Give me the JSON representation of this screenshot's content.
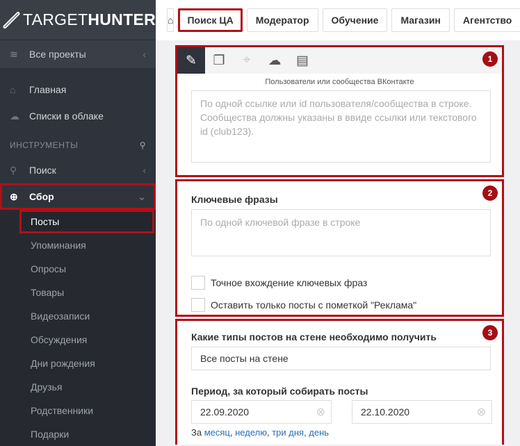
{
  "logo": {
    "light": "TARGET",
    "bold": "HUNTER"
  },
  "sidebar": {
    "projects": "Все проекты",
    "home": "Главная",
    "cloud": "Списки в облаке",
    "tools_header": "ИНСТРУМЕНТЫ",
    "search": "Поиск",
    "collect": "Сбор",
    "sub": [
      "Посты",
      "Упоминания",
      "Опросы",
      "Товары",
      "Видеозаписи",
      "Обсуждения",
      "Дни рождения",
      "Друзья",
      "Родственники",
      "Подарки"
    ]
  },
  "topbar": {
    "tabs": [
      "Поиск ЦА",
      "Модератор",
      "Обучение",
      "Магазин",
      "Агентство"
    ]
  },
  "panel1": {
    "badge": "1",
    "caption": "Пользователи или сообщества ВКонтакте",
    "placeholder": "По одной ссылке или id пользователя/сообщества в строке. Сообщества должны указаны в ввиде ссылки или текстового id (club123)."
  },
  "panel2": {
    "badge": "2",
    "label": "Ключевые фразы",
    "placeholder": "По одной ключевой фразе в строке",
    "cb1": "Точное вхождение ключевых фраз",
    "cb2": "Оставить только посты с пометкой \"Реклама\""
  },
  "panel3": {
    "badge": "3",
    "types_label": "Какие типы постов на стене необходимо получить",
    "types_value": "Все посты на стене",
    "period_label": "Период, за который собирать посты",
    "date_from": "22.09.2020",
    "date_to": "22.10.2020",
    "quick_prefix": "За",
    "quick": [
      "месяц",
      "неделю",
      "три дня",
      "день"
    ]
  },
  "colors": {
    "accent": "#b01018",
    "sidebar": "#2f333b"
  }
}
